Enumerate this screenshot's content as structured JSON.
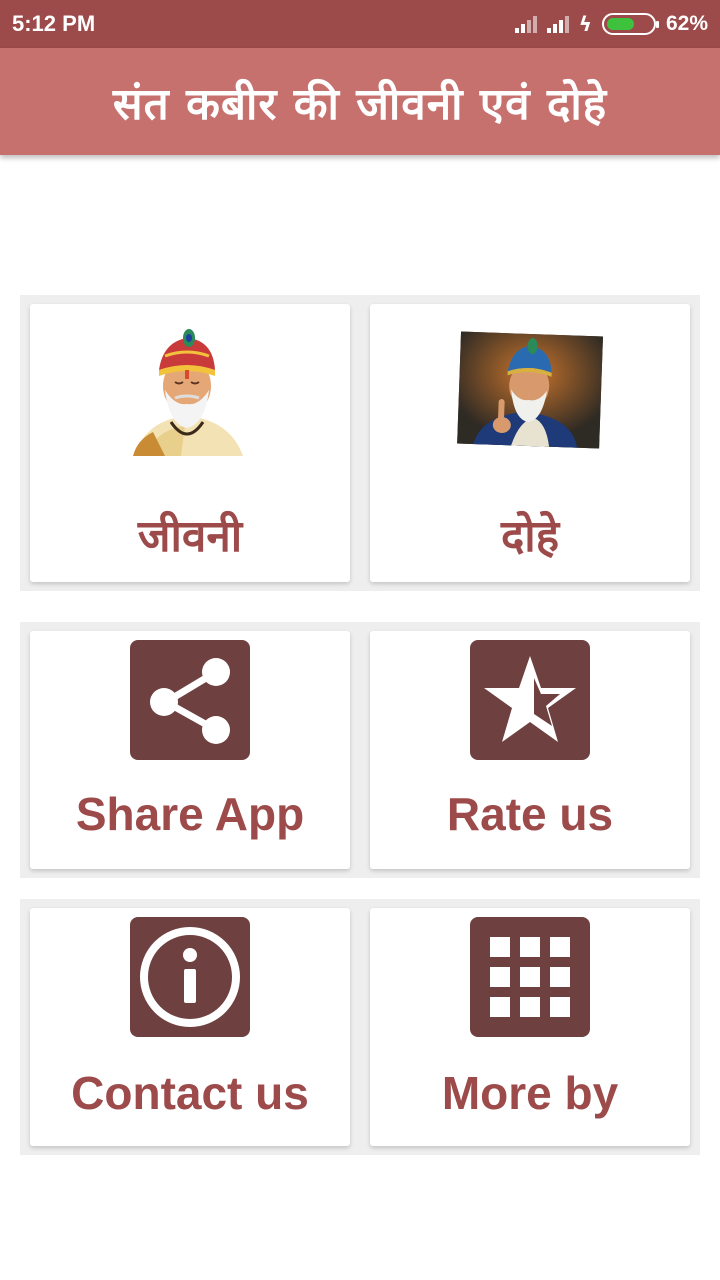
{
  "status_bar": {
    "time": "5:12 PM",
    "battery_percent": "62%",
    "battery_level": 0.62
  },
  "app_bar": {
    "title": "संत कबीर की जीवनी एवं दोहे"
  },
  "tiles": {
    "biography": {
      "label": "जीवनी",
      "icon": "kabir-portrait-image"
    },
    "couplets": {
      "label": "दोहे",
      "icon": "kabir-painting-image"
    },
    "share": {
      "label": "Share App",
      "icon": "share-icon"
    },
    "rate": {
      "label": "Rate us",
      "icon": "star-icon"
    },
    "contact": {
      "label": "Contact us",
      "icon": "info-icon"
    },
    "more": {
      "label": "More by",
      "icon": "grid-icon"
    }
  },
  "colors": {
    "status_bar": "#9c4a4a",
    "app_bar": "#c7716f",
    "accent_text": "#9c4a4a",
    "icon_tile": "#6e4040",
    "battery": "#3ec23e"
  }
}
